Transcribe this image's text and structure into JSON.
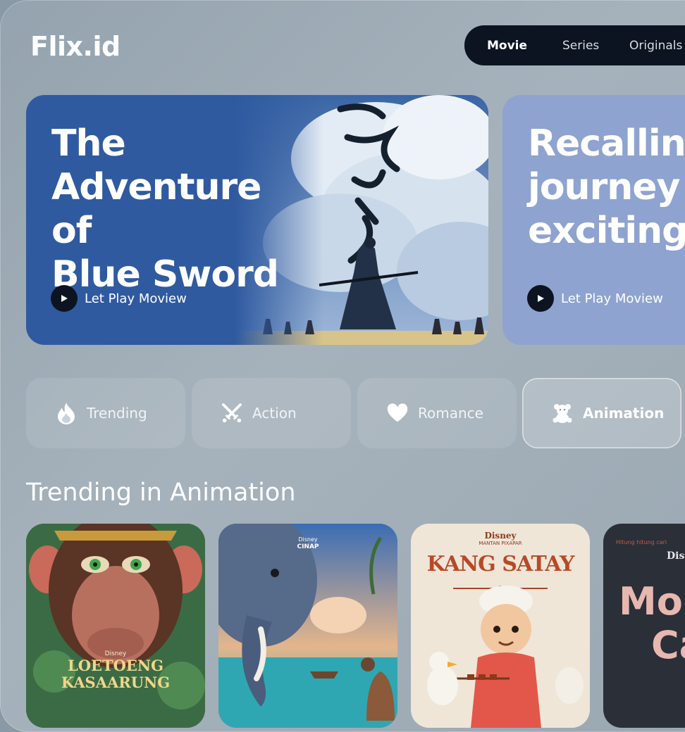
{
  "app": {
    "logo": "Flix.id"
  },
  "nav": {
    "tabs": [
      {
        "label": "Movie"
      },
      {
        "label": "Series"
      },
      {
        "label": "Originals"
      }
    ]
  },
  "heroes": [
    {
      "title_lines": [
        "The",
        "Adventure of",
        "Blue Sword"
      ],
      "play_label": "Let Play Moview"
    },
    {
      "title_lines": [
        "Recalling",
        "journey o",
        "exciting s"
      ],
      "play_label": "Let Play Moview"
    }
  ],
  "categories": [
    {
      "label": "Trending",
      "icon": "flame-icon"
    },
    {
      "label": "Action",
      "icon": "crossed-swords-icon"
    },
    {
      "label": "Romance",
      "icon": "heart-icon"
    },
    {
      "label": "Animation",
      "icon": "teddy-bear-icon"
    }
  ],
  "section": {
    "title": "Trending in Animation"
  },
  "posters": [
    {
      "studio": "Disney",
      "title_lines": [
        "LOETOENG",
        "KASAARUNG"
      ]
    },
    {
      "studio": "Disney",
      "sub": "CINAP"
    },
    {
      "studio": "Disney",
      "sub": "MANTAN PIXAPAR",
      "title": "KANG SATAY"
    },
    {
      "tagline": "Hitung hitung cari",
      "studio": "Dis",
      "title_lines": [
        "Mo",
        "Ca"
      ]
    }
  ],
  "colors": {
    "nav_bg": "#0b1420",
    "hero1_bg": "#2f5aa0",
    "hero2_bg": "#8ea3cf"
  }
}
